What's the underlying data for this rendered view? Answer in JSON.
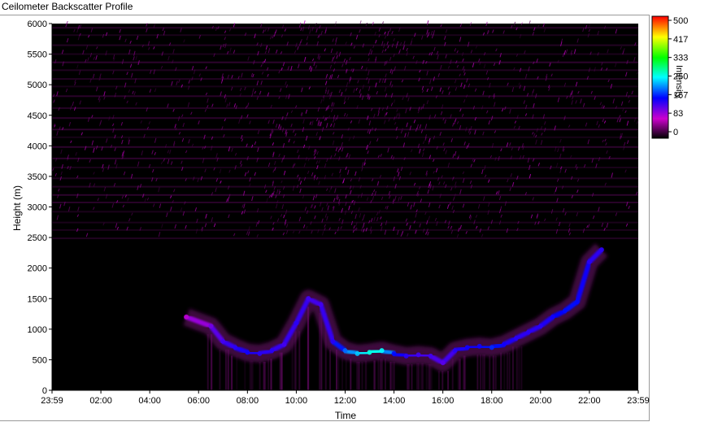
{
  "window": {
    "title": "Ceilometer Backscatter Profile"
  },
  "chart_data": {
    "type": "heatmap",
    "title": "Ceilometer Backscatter Profile",
    "xlabel": "Time",
    "ylabel": "Height (m)",
    "x_ticks": [
      "23:59",
      "02:00",
      "04:00",
      "06:00",
      "08:00",
      "10:00",
      "12:00",
      "14:00",
      "16:00",
      "18:00",
      "20:00",
      "22:00",
      "23:59"
    ],
    "y_ticks": [
      0,
      500,
      1000,
      1500,
      2000,
      2500,
      3000,
      3500,
      4000,
      4500,
      5000,
      5500,
      6000
    ],
    "ylim": [
      0,
      6000
    ],
    "background_color": "#000000",
    "colorbar": {
      "label": "Intensity",
      "ticks": [
        "500",
        "417",
        "333",
        "250",
        "167",
        "83",
        "0"
      ],
      "range": [
        0,
        500
      ],
      "colors": [
        "#000000",
        "#cc00cc",
        "#0000ff",
        "#00ffff",
        "#00ff00",
        "#ffff00",
        "#ff0000"
      ]
    },
    "cloud_layer": {
      "name": "",
      "x_hours": [
        5.5,
        6.5,
        7.0,
        7.5,
        8.0,
        8.5,
        9.0,
        9.5,
        10.0,
        10.5,
        11.0,
        11.5,
        12.0,
        12.5,
        13.0,
        13.5,
        14.0,
        14.5,
        15.0,
        15.5,
        16.0,
        16.5,
        17.0,
        17.5,
        18.0,
        18.5,
        19.0,
        19.5,
        20.0,
        20.5,
        21.0,
        21.5,
        22.0,
        22.5
      ],
      "height_m": [
        1200,
        1050,
        800,
        700,
        620,
        600,
        650,
        750,
        1100,
        1500,
        1400,
        800,
        650,
        600,
        620,
        650,
        600,
        560,
        580,
        560,
        450,
        650,
        700,
        720,
        700,
        750,
        850,
        950,
        1050,
        1200,
        1300,
        1450,
        2100,
        2300
      ],
      "peak_intensity": [
        90,
        120,
        140,
        150,
        160,
        150,
        150,
        140,
        150,
        140,
        140,
        150,
        200,
        230,
        260,
        250,
        170,
        150,
        140,
        140,
        130,
        150,
        160,
        160,
        180,
        160,
        150,
        150,
        150,
        160,
        170,
        170,
        150,
        150
      ]
    },
    "noise_region": {
      "height_m": [
        2500,
        6000
      ],
      "peak_intensity": 80
    }
  }
}
